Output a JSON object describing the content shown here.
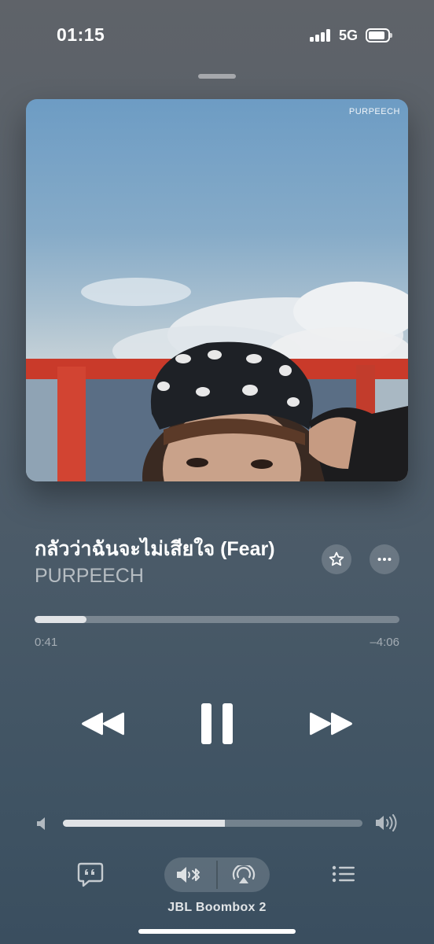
{
  "status_bar": {
    "time": "01:15",
    "network": "5G"
  },
  "artwork": {
    "label": "PURPEECH"
  },
  "now_playing": {
    "title": "กลัวว่าฉันจะไม่เสียใจ (Fear)",
    "artist": "PURPEECH",
    "elapsed": "0:41",
    "remaining": "–4:06",
    "progress_fraction": 0.143
  },
  "volume": {
    "level_fraction": 0.54
  },
  "output": {
    "device_name": "JBL Boombox 2"
  },
  "icons": {
    "star": "star-icon",
    "more": "ellipsis-icon",
    "rewind": "rewind-icon",
    "pause": "pause-icon",
    "forward": "fast-forward-icon",
    "lyrics": "lyrics-icon",
    "speaker_bluetooth": "speaker-bluetooth-icon",
    "airplay": "airplay-audio-icon",
    "queue": "queue-list-icon"
  }
}
